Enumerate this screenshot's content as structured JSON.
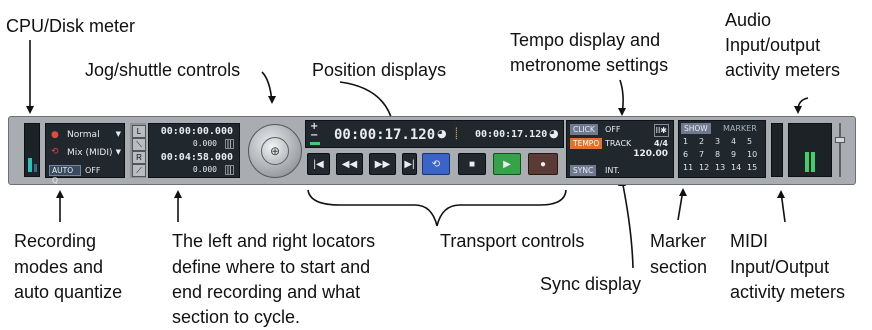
{
  "annotations": {
    "cpu_disk": "CPU/Disk meter",
    "audio_1": "Audio",
    "audio_2": "Input/output",
    "audio_3": "activity meters",
    "tempo_1": "Tempo display and",
    "tempo_2": "metronome settings",
    "jog": "Jog/shuttle controls",
    "position": "Position displays",
    "rec_1": "Recording",
    "rec_2": "modes and",
    "rec_3": "auto quantize",
    "loc_1": "The left and right locators",
    "loc_2": "define where to start and",
    "loc_3": "end recording and what",
    "loc_4": "section to cycle.",
    "transport": "Transport controls",
    "marker_1": "Marker",
    "marker_2": "section",
    "sync": "Sync display",
    "midi_1": "MIDI",
    "midi_2": "Input/Output",
    "midi_3": "activity meters"
  },
  "panel": {
    "rec_mode": "Normal",
    "mix_mode": "Mix (MIDI)",
    "autoq_label": "AUTO Q",
    "autoq_value": "OFF",
    "locator_left": "00:00:00.000",
    "locator_left_small": "0.000",
    "locator_right": "00:04:58.000",
    "locator_right_small": "0.000",
    "loc_L": "L",
    "loc_R": "R",
    "position_main": "00:00:17.120",
    "position_secondary": "00:00:17.120",
    "click_label": "CLICK",
    "click_value": "OFF",
    "tempo_label": "TEMPO",
    "track_label": "TRACK",
    "signature": "4/4",
    "tempo_value": "120.00",
    "sync_label": "SYNC",
    "sync_value": "INT.",
    "show_label": "SHOW",
    "marker_label": "MARKER",
    "markers_row1": [
      "1",
      "2",
      "3",
      "4",
      "5"
    ],
    "markers_row2": [
      "6",
      "7",
      "8",
      "9",
      "10"
    ],
    "markers_row3": [
      "11",
      "12",
      "13",
      "14",
      "15"
    ]
  },
  "colors": {
    "panel": "#a9adb1",
    "lcd": "#20272d",
    "tempo_active": "#e0702c",
    "cycle_button": "#3a64c8",
    "play_button": "#36a24a",
    "meter_green": "#3fd06a"
  }
}
